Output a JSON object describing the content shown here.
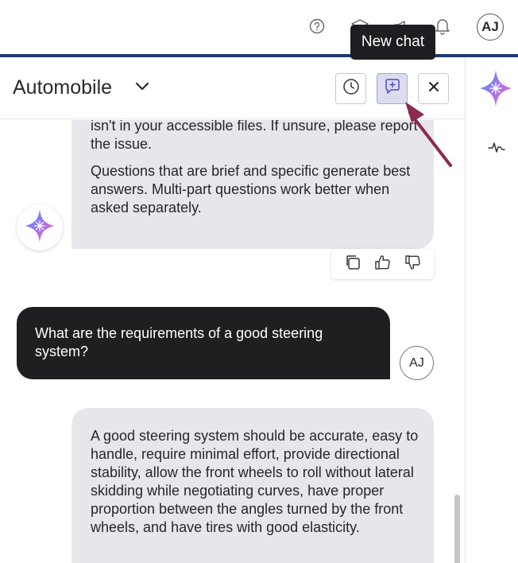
{
  "topbar": {
    "icons": [
      "help-icon",
      "graduation-cap-icon",
      "megaphone-icon",
      "bell-icon"
    ],
    "avatar_initials": "AJ"
  },
  "tooltip": {
    "text": "New chat"
  },
  "header": {
    "title": "Automobile",
    "buttons": [
      "history-icon",
      "new-chat-icon",
      "close-icon"
    ]
  },
  "messages": {
    "bot_1": {
      "paragraph_1": "isn't in your accessible files. If unsure, please report the issue.",
      "paragraph_2": "Questions that are brief and specific generate best answers. Multi-part questions work better when asked separately."
    },
    "user_1": {
      "text": "What are the requirements of a good steering system?",
      "avatar_initials": "AJ"
    },
    "bot_2": {
      "text": "A good steering system should be accurate, easy to handle, require minimal effort, provide directional stability, allow the front wheels to roll without lateral skidding while negotiating curves, have proper proportion between the angles turned by the front wheels, and have tires with good elasticity."
    }
  },
  "colors": {
    "accent_bar": "#1e3a6e",
    "annotation_arrow": "#8b2a4e",
    "user_bubble": "#1f1f22",
    "bot_bubble": "#e6e6eb"
  }
}
